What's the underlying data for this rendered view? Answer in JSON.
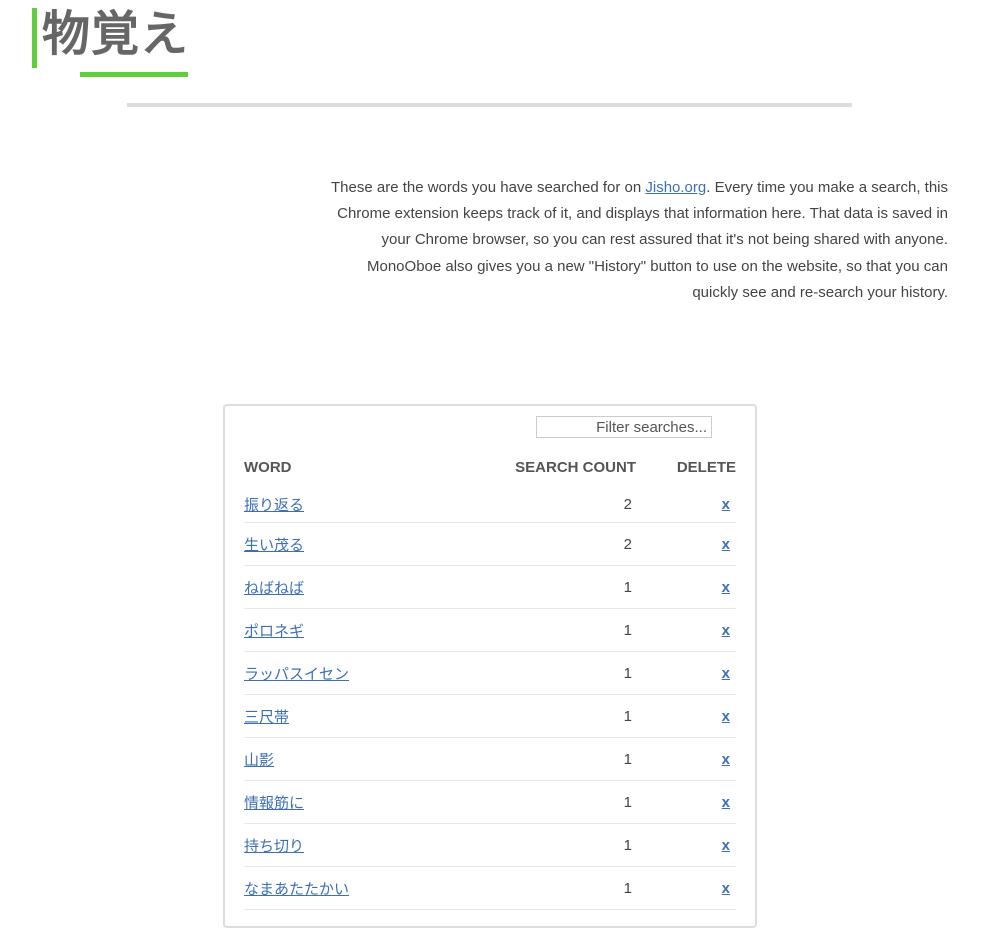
{
  "logo": {
    "text": "物覚え"
  },
  "intro": {
    "before_link": "These are the words you have searched for on ",
    "link_text": "Jisho.org",
    "after_link": ". Every time you make a search, this Chrome extension keeps track of it, and displays that information here. That data is saved in your Chrome browser, so you can rest assured that it's not being shared with anyone. MonoOboe also gives you a new \"History\" button to use on the website, so that you can quickly see and re-search your history."
  },
  "search": {
    "placeholder": "Filter searches..."
  },
  "table": {
    "headers": {
      "word": "WORD",
      "count": "SEARCH COUNT",
      "delete": "DELETE"
    },
    "delete_label": "x",
    "rows": [
      {
        "word": "振り返る",
        "count": "2"
      },
      {
        "word": "生い茂る",
        "count": "2"
      },
      {
        "word": "ねばねば",
        "count": "1"
      },
      {
        "word": "ポロネギ",
        "count": "1"
      },
      {
        "word": "ラッパスイセン",
        "count": "1"
      },
      {
        "word": "三尺帯",
        "count": "1"
      },
      {
        "word": "山影",
        "count": "1"
      },
      {
        "word": "情報筋に",
        "count": "1"
      },
      {
        "word": "持ち切り",
        "count": "1"
      },
      {
        "word": "なまあたたかい",
        "count": "1"
      }
    ]
  },
  "colors": {
    "accent": "#5fcf3f",
    "link": "#3d6fb6",
    "logo_text": "#666666",
    "rule": "#dddddd"
  }
}
